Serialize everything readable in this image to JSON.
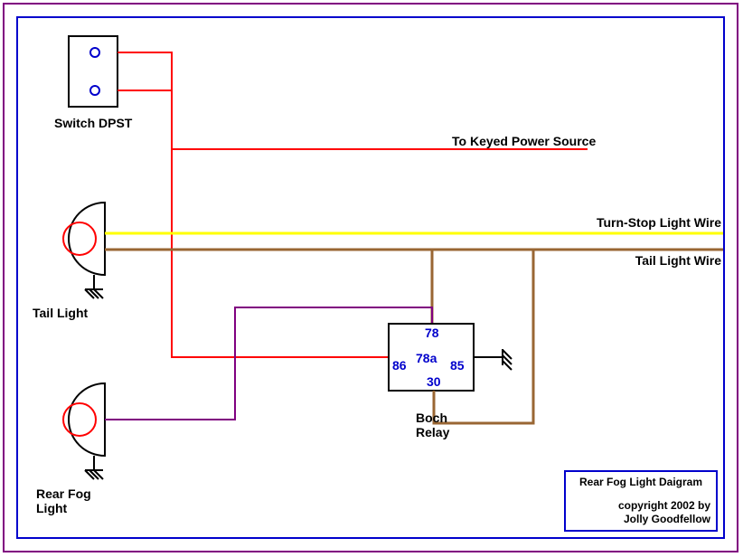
{
  "labels": {
    "switch": "Switch DPST",
    "keyed_power": "To Keyed Power Source",
    "turn_stop": "Turn-Stop Light Wire",
    "tail_wire": "Tail Light Wire",
    "tail_light": "Tail Light",
    "rear_fog": "Rear Fog",
    "rear_fog2": "Light",
    "relay1": "Boch",
    "relay2": "Relay"
  },
  "relay_pins": {
    "p78": "78",
    "p78a": "78a",
    "p86": "86",
    "p85": "85",
    "p30": "30"
  },
  "info": {
    "title": "Rear Fog Light Daigram",
    "copyright1": "copyright 2002 by",
    "copyright2": "Jolly Goodfellow"
  },
  "colors": {
    "red": "#ff0000",
    "yellow": "#ffff00",
    "tan": "#996633",
    "purple": "#800080",
    "blue": "#0000cc",
    "black": "#000000"
  }
}
